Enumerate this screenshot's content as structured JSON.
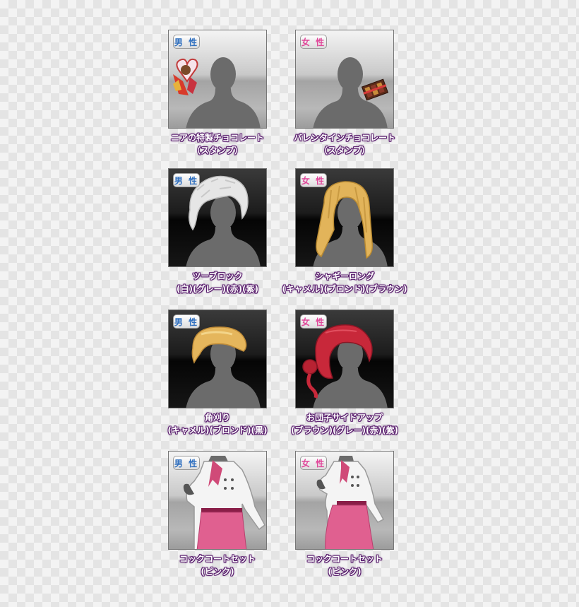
{
  "colors": {
    "male_badge": "#2f6fbf",
    "female_badge": "#e0489a",
    "label_outline": "#5a1f6e",
    "silhouette": "#6b6b6b"
  },
  "items": [
    {
      "badge": "男 性",
      "gender": "male",
      "background": "light",
      "icon": "chocolate-stamp-icon",
      "line1": "ニアの特製チョコレート",
      "line2": "（スタンプ）"
    },
    {
      "badge": "女 性",
      "gender": "female",
      "background": "light",
      "icon": "chocolate-box-icon",
      "line1": "バレンタインチョコレート",
      "line2": "（スタンプ）"
    },
    {
      "badge": "男 性",
      "gender": "male",
      "background": "dark",
      "icon": "white-hair-icon",
      "line1": "ツーブロック",
      "line2": "(白)(グレー)(赤)(紫)"
    },
    {
      "badge": "女 性",
      "gender": "female",
      "background": "dark",
      "icon": "blonde-long-hair-icon",
      "line1": "シャギーロング",
      "line2": "(キャメル)(ブロンド)(ブラウン)"
    },
    {
      "badge": "男 性",
      "gender": "male",
      "background": "dark",
      "icon": "crew-cut-hair-icon",
      "line1": "角刈り",
      "line2": "(キャメル)(ブロンド)(黒)"
    },
    {
      "badge": "女 性",
      "gender": "female",
      "background": "dark",
      "icon": "red-side-bun-hair-icon",
      "line1": "お団子サイドアップ",
      "line2": "(ブラウン)(グレー)(赤)(紫)"
    },
    {
      "badge": "男 性",
      "gender": "male",
      "background": "light",
      "icon": "chef-coat-icon",
      "line1": "コックコートセット",
      "line2": "(ピンク)"
    },
    {
      "badge": "女 性",
      "gender": "female",
      "background": "light",
      "icon": "chef-coat-icon",
      "line1": "コックコートセット",
      "line2": "(ピンク)"
    }
  ]
}
